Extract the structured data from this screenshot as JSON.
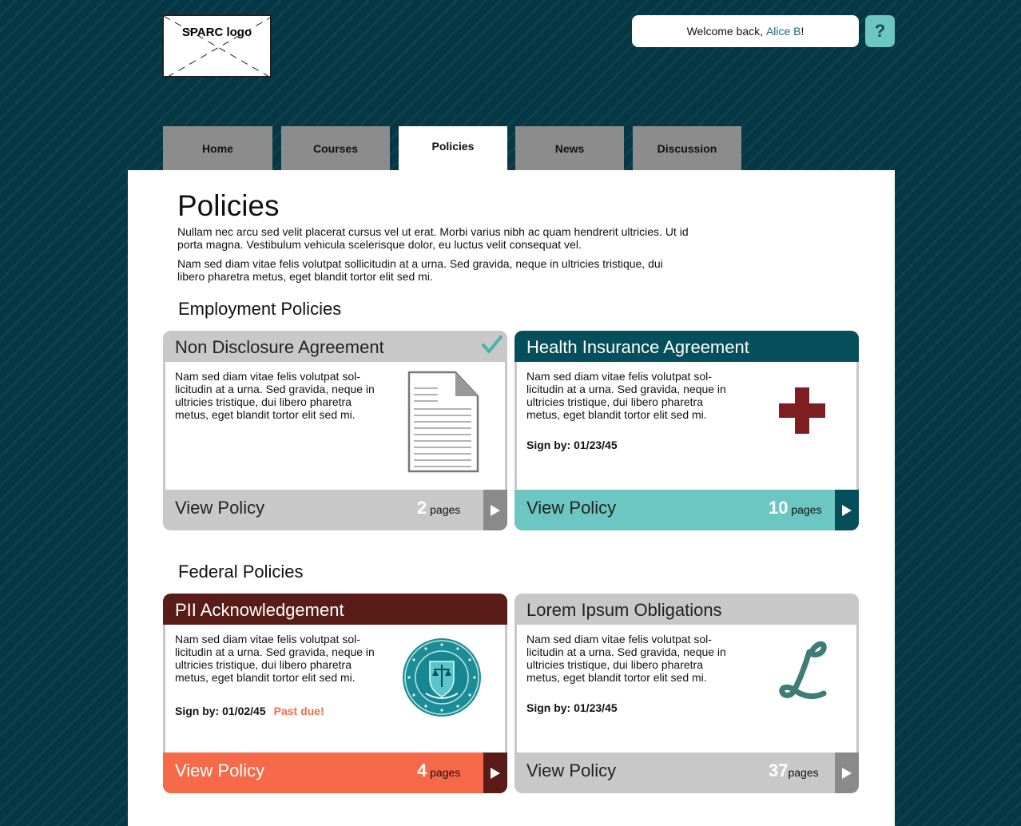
{
  "header": {
    "logo_text": "SPARC logo",
    "welcome_prefix": "Welcome back, ",
    "user_name": "Alice B",
    "welcome_suffix": "!",
    "help_label": "?"
  },
  "tabs": [
    {
      "label": "Home",
      "active": false
    },
    {
      "label": "Courses",
      "active": false
    },
    {
      "label": "Policies",
      "active": true
    },
    {
      "label": "News",
      "active": false
    },
    {
      "label": "Discussion",
      "active": false
    }
  ],
  "page": {
    "title": "Policies",
    "intro_1": "Nullam nec arcu sed velit placerat cursus vel ut erat. Morbi varius nibh ac quam hendrerit ultricies. Ut id porta magna. Vestibulum vehicula scelerisque dolor, eu luctus velit consequat vel.",
    "intro_2": "Nam sed diam vitae felis volutpat sollicitudin at a urna. Sed gravida, neque in ultricies tristique, dui libero pharetra metus, eget blandit tortor elit sed mi."
  },
  "sections": {
    "employment_title": "Employment Policies",
    "federal_title": "Federal Policies"
  },
  "cards": [
    {
      "title": "Non Disclosure Agreement",
      "description": "Nam sed diam vitae felis volutpat sol-licitudin at a urna. Sed gravida, neque in ultricies tristique, dui libero pharetra metus, eget blandit tortor elit sed mi.",
      "sign_by": "",
      "status": "",
      "view_label": "View Policy",
      "page_count": "2",
      "pages_label": "pages",
      "icon": "document-icon",
      "completed": true,
      "colors": {
        "header": "#c8c8c8",
        "title": "#222222",
        "footer": "#c8c8c8",
        "arrow": "#8a8a8a",
        "view": "#222222"
      }
    },
    {
      "title": "Health Insurance Agreement",
      "description": "Nam sed diam vitae felis volutpat sol-licitudin at a urna. Sed gravida, neque in ultricies tristique, dui libero pharetra metus, eget blandit tortor elit sed mi.",
      "sign_by": "Sign by: 01/23/45",
      "status": "",
      "view_label": "View Policy",
      "page_count": "10",
      "pages_label": "pages",
      "icon": "medical-cross-icon",
      "completed": false,
      "colors": {
        "header": "#054f5c",
        "title": "#ffffff",
        "footer": "#6cc7c2",
        "arrow": "#054f5c",
        "view": "#222222"
      }
    },
    {
      "title": "PII Acknowledgement",
      "description": "Nam sed diam vitae felis volutpat sol-licitudin at a urna. Sed gravida, neque in ultricies tristique, dui libero pharetra metus, eget blandit tortor elit sed mi.",
      "sign_by": "Sign by: 01/02/45",
      "status": "Past due!",
      "view_label": "View Policy",
      "page_count": "4",
      "pages_label": "pages",
      "icon": "ftc-seal-icon",
      "completed": false,
      "colors": {
        "header": "#5a1c17",
        "title": "#ffffff",
        "footer": "#f66a4a",
        "arrow": "#5a1c17",
        "view": "#ffffff"
      }
    },
    {
      "title": "Lorem Ipsum Obligations",
      "description": "Nam sed diam vitae felis volutpat sol-licitudin at a urna. Sed gravida, neque in ultricies tristique, dui libero pharetra metus, eget blandit tortor elit sed mi.",
      "sign_by": "Sign by: 01/23/45",
      "status": "",
      "view_label": "View Policy",
      "page_count": "37",
      "pages_label": "pages",
      "icon": "script-l-icon",
      "completed": false,
      "colors": {
        "header": "#c8c8c8",
        "title": "#222222",
        "footer": "#c8c8c8",
        "arrow": "#8a8a8a",
        "view": "#222222"
      }
    }
  ]
}
